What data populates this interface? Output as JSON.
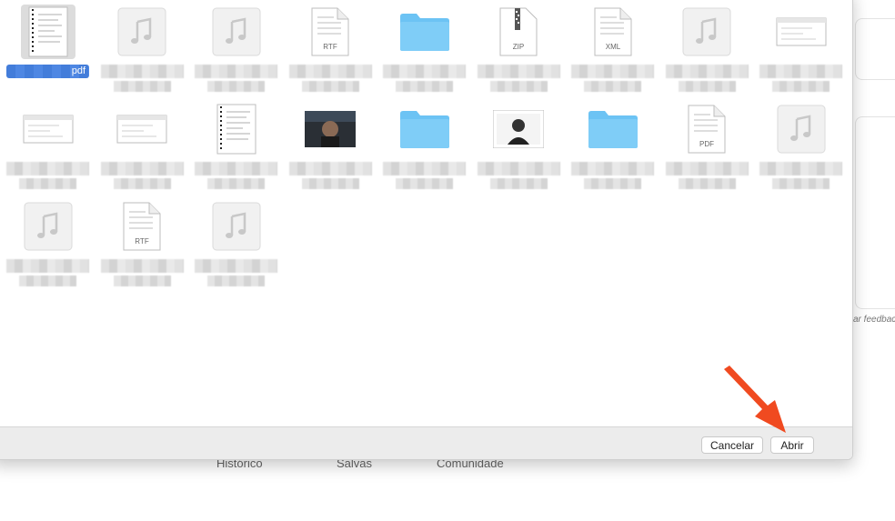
{
  "background_page": {
    "nav": [
      "Histórico",
      "Salvas",
      "Comunidade"
    ],
    "feedback_text": "ar feedback"
  },
  "file_grid": {
    "items": [
      {
        "kind": "document-pdf-preview",
        "name": "pdf",
        "selected": true
      },
      {
        "kind": "audio",
        "name": ""
      },
      {
        "kind": "audio",
        "name": ""
      },
      {
        "kind": "rtf",
        "name": "",
        "badge": "RTF"
      },
      {
        "kind": "folder",
        "name": ""
      },
      {
        "kind": "zip",
        "name": "",
        "badge": "ZIP"
      },
      {
        "kind": "xml",
        "name": "",
        "badge": "XML"
      },
      {
        "kind": "audio",
        "name": ""
      },
      {
        "kind": "screenshot",
        "name": ""
      },
      {
        "kind": "screenshot",
        "name": ""
      },
      {
        "kind": "screenshot",
        "name": ""
      },
      {
        "kind": "document-preview",
        "name": ""
      },
      {
        "kind": "video",
        "name": ""
      },
      {
        "kind": "folder",
        "name": ""
      },
      {
        "kind": "photo",
        "name": ""
      },
      {
        "kind": "folder",
        "name": ""
      },
      {
        "kind": "pdf",
        "name": "",
        "badge": "PDF"
      },
      {
        "kind": "audio",
        "name": ""
      },
      {
        "kind": "audio",
        "name": ""
      },
      {
        "kind": "rtf",
        "name": "",
        "badge": "RTF"
      },
      {
        "kind": "audio",
        "name": ""
      }
    ]
  },
  "footer": {
    "cancel_label": "Cancelar",
    "open_label": "Abrir"
  },
  "colors": {
    "selection": "#2f6fd6",
    "folder": "#6cc3f4",
    "arrow": "#f04a20"
  }
}
